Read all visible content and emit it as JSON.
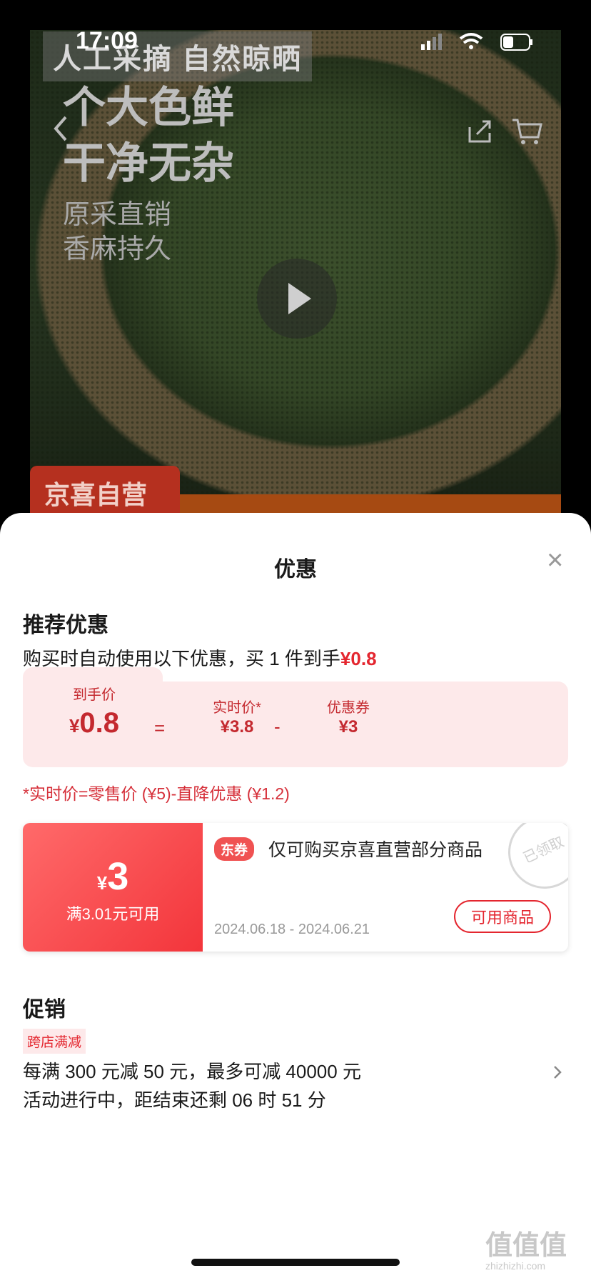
{
  "status_bar": {
    "time": "17:09"
  },
  "hero": {
    "tag_text": "人工采摘 自然晾晒",
    "headline_1": "个大色鲜",
    "headline_2": "干净无杂",
    "sub_1": "原采直销",
    "sub_2": "香麻持久",
    "stamp_text": "京喜自营"
  },
  "sheet": {
    "title": "优惠",
    "close_symbol": "×",
    "recommend": {
      "title": "推荐优惠",
      "desc_prefix": "购买时自动使用以下优惠，买 1 件到手",
      "desc_price": "¥0.8"
    },
    "calc": {
      "final_label": "到手价",
      "final_yen": "¥",
      "final_value": "0.8",
      "eq": "=",
      "realtime_label": "实时价*",
      "realtime_value": "¥3.8",
      "minus": "-",
      "coupon_label": "优惠券",
      "coupon_value": "¥3"
    },
    "formula": "*实时价=零售价 (¥5)-直降优惠 (¥1.2)",
    "coupon": {
      "yen": "¥",
      "amount": "3",
      "condition": "满3.01元可用",
      "tag": "东券",
      "desc": "仅可购买京喜直营部分商品",
      "date": "2024.06.18 - 2024.06.21",
      "button": "可用商品",
      "claimed_stamp": "已领取"
    },
    "promo": {
      "title": "促销",
      "tag": "跨店满减",
      "line1": "每满 300 元减 50 元，最多可减 40000 元",
      "line2": "活动进行中，距结束还剩 06 时 51 分"
    }
  },
  "watermark": {
    "main": "值值值",
    "sub": "zhizhizhi.com"
  }
}
